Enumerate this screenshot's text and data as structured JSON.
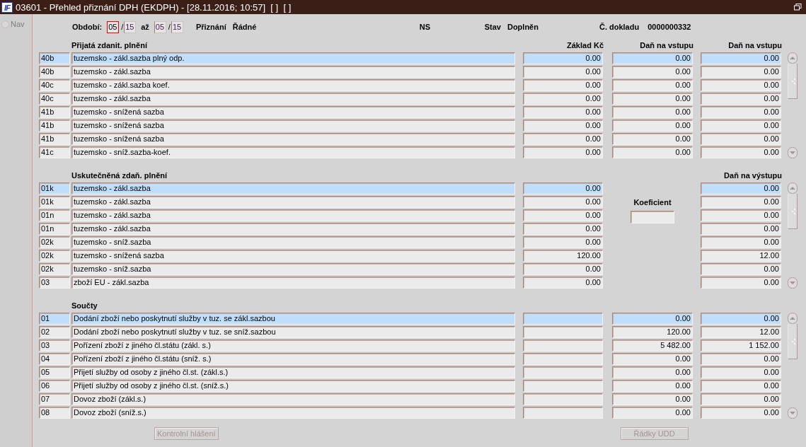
{
  "window": {
    "logo": "IF",
    "title": "03601 - Přehled přiznání DPH (EKDPH) - [28.11.2016; 10:57]  [ ]  [ ]"
  },
  "nav": {
    "label": "Nav",
    "disabled": true,
    "selected": false
  },
  "header": {
    "period_label": "Období:",
    "from": [
      {
        "value": "05",
        "focused": true
      },
      {
        "value": "15",
        "focused": false
      }
    ],
    "separator": "/",
    "to_label": "až",
    "to": [
      {
        "value": "05",
        "focused": false
      },
      {
        "value": "15",
        "focused": false
      }
    ],
    "return_label": "Přiznání",
    "return_type": "Řádné",
    "ns_label": "NS",
    "status_label": "Stav",
    "status": "Doplněn",
    "doc_label": "Č. dokladu",
    "doc_number": "0000000332"
  },
  "sections": [
    {
      "kind": "received",
      "title": "Přijatá zdanit. plnění",
      "headers": {
        "base": "Základ Kč",
        "tax": "Daň na vstupu",
        "tax_2": "Daň na vstupu"
      },
      "rows": [
        {
          "code": "40b",
          "text": "tuzemsko - zákl.sazba plný odp.",
          "base": "0.00",
          "tax": "0.00",
          "tax_2": "0.00",
          "selected": true
        },
        {
          "code": "40b",
          "text": "tuzemsko - zákl.sazba",
          "base": "0.00",
          "tax": "0.00",
          "tax_2": "0.00",
          "selected": false
        },
        {
          "code": "40c",
          "text": "tuzemsko - zákl.sazba koef.",
          "base": "0.00",
          "tax": "0.00",
          "tax_2": "0.00",
          "selected": false
        },
        {
          "code": "40c",
          "text": "tuzemsko - zákl.sazba",
          "base": "0.00",
          "tax": "0.00",
          "tax_2": "0.00",
          "selected": false
        },
        {
          "code": "41b",
          "text": "tuzemsko - snížená sazba",
          "base": "0.00",
          "tax": "0.00",
          "tax_2": "0.00",
          "selected": false
        },
        {
          "code": "41b",
          "text": "tuzemsko - snížená sazba",
          "base": "0.00",
          "tax": "0.00",
          "tax_2": "0.00",
          "selected": false
        },
        {
          "code": "41b",
          "text": "tuzemsko - snížená sazba",
          "base": "0.00",
          "tax": "0.00",
          "tax_2": "0.00",
          "selected": false
        },
        {
          "code": "41c",
          "text": "tuzemsko - sníž.sazba-koef.",
          "base": "0.00",
          "tax": "0.00",
          "tax_2": "0.00",
          "selected": false
        }
      ]
    },
    {
      "kind": "coefficient",
      "title": "Uskutečněná zdaň. plnění",
      "headers": {
        "tax_2": "Daň na výstupu"
      },
      "coefficient_label": "Koeficient",
      "rows": [
        {
          "code": "01k",
          "text": "tuzemsko - zákl.sazba",
          "base": "0.00",
          "tax_2": "0.00",
          "selected": true
        },
        {
          "code": "01k",
          "text": "tuzemsko - zákl.sazba",
          "base": "0.00",
          "tax_2": "0.00",
          "selected": false
        },
        {
          "code": "01n",
          "text": "tuzemsko - zákl.sazba",
          "base": "0.00",
          "tax_2": "0.00",
          "selected": false
        },
        {
          "code": "01n",
          "text": "tuzemsko - zákl.sazba",
          "base": "0.00",
          "tax_2": "0.00",
          "selected": false
        },
        {
          "code": "02k",
          "text": "tuzemsko - sníž.sazba",
          "base": "0.00",
          "tax_2": "0.00",
          "selected": false
        },
        {
          "code": "02k",
          "text": "tuzemsko - snížená sazba",
          "base": "120.00",
          "tax_2": "12.00",
          "selected": false
        },
        {
          "code": "02k",
          "text": "tuzemsko - sníž.sazba",
          "base": "0.00",
          "tax_2": "0.00",
          "selected": false
        },
        {
          "code": "03",
          "text": "zboží EU - zákl.sazba",
          "base": "0.00",
          "tax_2": "0.00",
          "selected": false
        }
      ]
    },
    {
      "kind": "totals",
      "title": "Součty",
      "rows": [
        {
          "code": "01",
          "text": "Dodání zboží nebo poskytnutí služby v tuz. se zákl.sazbou",
          "tax": "0.00",
          "tax_2": "0.00",
          "selected": true
        },
        {
          "code": "02",
          "text": "Dodání zboží nebo poskytnutí služby v tuz. se sníž.sazbou",
          "tax": "120.00",
          "tax_2": "12.00",
          "selected": false
        },
        {
          "code": "03",
          "text": "Pořízení zboží z jiného čl.státu (zákl. s.)",
          "tax": "5 482.00",
          "tax_2": "1 152.00",
          "selected": false
        },
        {
          "code": "04",
          "text": "Pořízení zboží z jiného čl.státu (sníž. s.)",
          "tax": "0.00",
          "tax_2": "0.00",
          "selected": false
        },
        {
          "code": "05",
          "text": "Přijetí služby od osoby z jiného čl.st. (zákl.s.)",
          "tax": "0.00",
          "tax_2": "0.00",
          "selected": false
        },
        {
          "code": "06",
          "text": "Přijetí služby od osoby z jiného čl.st. (sníž.s.)",
          "tax": "0.00",
          "tax_2": "0.00",
          "selected": false
        },
        {
          "code": "07",
          "text": "Dovoz zboží (zákl.s.)",
          "tax": "0.00",
          "tax_2": "0.00",
          "selected": false
        },
        {
          "code": "08",
          "text": "Dovoz zboží (sníž.s.)",
          "tax": "0.00",
          "tax_2": "0.00",
          "selected": false
        }
      ]
    }
  ],
  "buttons": [
    {
      "label": "Kontrolní hlášení",
      "disabled": true
    },
    {
      "label": "Řádky UDD",
      "disabled": true
    }
  ]
}
